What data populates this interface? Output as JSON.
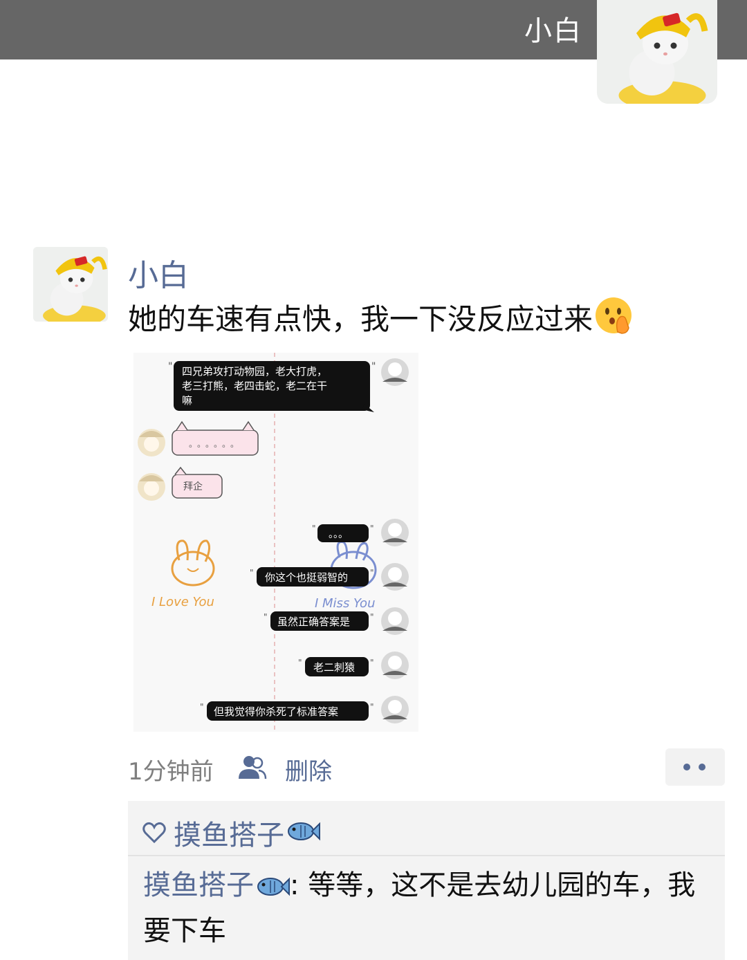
{
  "cover": {
    "name": "小白"
  },
  "post": {
    "author": "小白",
    "text": "她的车速有点快，我一下没反应过来",
    "image": {
      "question": "四兄弟攻打动物园，老大打虎，老三打熊，老四击蛇，老二在干嘛",
      "question_lines": [
        "四兄弟攻打动物园，老大打虎，",
        "老三打熊，老四击蛇，老二在干",
        "嘛"
      ],
      "left_reply_1": "。。。。。。",
      "left_reply_2": "拜企",
      "left_sticker_caption": "I Love You",
      "right_sticker_caption": "I Miss You",
      "replies": [
        "。。。",
        "你这个也挺弱智的",
        "虽然正确答案是",
        "老二刺猿",
        "但我觉得你杀死了标准答案"
      ]
    },
    "time": "1分钟前",
    "delete_label": "删除"
  },
  "interactions": {
    "likes": [
      "摸鱼搭子"
    ],
    "comments": [
      {
        "author": "摸鱼搭子",
        "separator": ": ",
        "text": "等等，这不是去幼儿园的车，我要下车"
      }
    ]
  },
  "colors": {
    "link": "#576b95",
    "cover_band": "#666666",
    "interaction_bg": "#f3f3f3"
  },
  "icons": [
    "cat-avatar",
    "shushing-face-emoji",
    "friends-visibility-icon",
    "more-dots-icon",
    "heart-icon",
    "fish-icon"
  ]
}
